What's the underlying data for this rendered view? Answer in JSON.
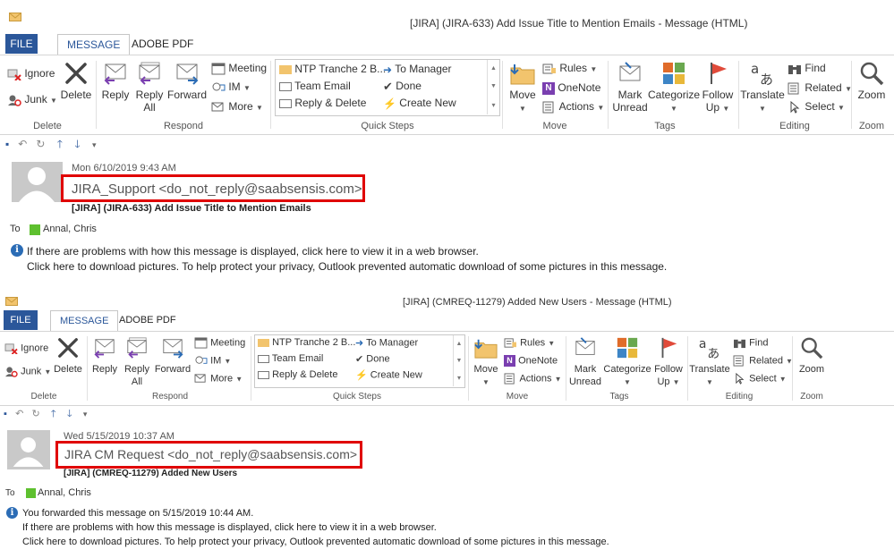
{
  "windows": [
    {
      "title": "[JIRA] (JIRA-633) Add Issue Title to Mention Emails - Message (HTML)",
      "tabs": [
        "FILE",
        "MESSAGE",
        "ADOBE PDF"
      ],
      "ribbon": {
        "delete": {
          "ignore": "Ignore",
          "junk": "Junk",
          "delete": "Delete",
          "label": "Delete"
        },
        "respond": {
          "reply": "Reply",
          "reply_all_1": "Reply",
          "reply_all_2": "All",
          "forward": "Forward",
          "meeting": "Meeting",
          "im": "IM",
          "more": "More",
          "label": "Respond"
        },
        "quick_steps": {
          "items": [
            "NTP Tranche 2 B...",
            "To Manager",
            "Team Email",
            "Done",
            "Reply & Delete",
            "Create New"
          ],
          "label": "Quick Steps"
        },
        "move": {
          "move": "Move",
          "rules": "Rules",
          "onenote": "OneNote",
          "actions": "Actions",
          "label": "Move"
        },
        "tags": {
          "mark_1": "Mark",
          "mark_2": "Unread",
          "categorize": "Categorize",
          "follow_1": "Follow",
          "follow_2": "Up",
          "label": "Tags"
        },
        "editing": {
          "translate": "Translate",
          "find": "Find",
          "related": "Related",
          "select": "Select",
          "label": "Editing"
        },
        "zoom": {
          "zoom": "Zoom",
          "label": "Zoom"
        }
      },
      "message": {
        "date": "Mon 6/10/2019 9:43 AM",
        "sender": "JIRA_Support <do_not_reply@saabsensis.com>",
        "subject": "[JIRA] (JIRA-633) Add Issue Title to Mention Emails",
        "to_label": "To",
        "to_name": "Annal, Chris",
        "info_lines": [
          "If there are problems with how this message is displayed, click here to view it in a web browser.",
          "Click here to download pictures. To help protect your privacy, Outlook prevented automatic download of some pictures in this message."
        ]
      }
    },
    {
      "title": "[JIRA] (CMREQ-11279) Added New Users - Message (HTML)",
      "tabs": [
        "FILE",
        "MESSAGE",
        "ADOBE PDF"
      ],
      "ribbon": {
        "delete": {
          "ignore": "Ignore",
          "junk": "Junk",
          "delete": "Delete",
          "label": "Delete"
        },
        "respond": {
          "reply": "Reply",
          "reply_all_1": "Reply",
          "reply_all_2": "All",
          "forward": "Forward",
          "meeting": "Meeting",
          "im": "IM",
          "more": "More",
          "label": "Respond"
        },
        "quick_steps": {
          "items": [
            "NTP Tranche 2 B...",
            "To Manager",
            "Team Email",
            "Done",
            "Reply & Delete",
            "Create New"
          ],
          "label": "Quick Steps"
        },
        "move": {
          "move": "Move",
          "rules": "Rules",
          "onenote": "OneNote",
          "actions": "Actions",
          "label": "Move"
        },
        "tags": {
          "mark_1": "Mark",
          "mark_2": "Unread",
          "categorize": "Categorize",
          "follow_1": "Follow",
          "follow_2": "Up",
          "label": "Tags"
        },
        "editing": {
          "translate": "Translate",
          "find": "Find",
          "related": "Related",
          "select": "Select",
          "label": "Editing"
        },
        "zoom": {
          "zoom": "Zoom",
          "label": "Zoom"
        }
      },
      "message": {
        "date": "Wed 5/15/2019 10:37 AM",
        "sender": "JIRA CM Request <do_not_reply@saabsensis.com>",
        "subject": "[JIRA] (CMREQ-11279) Added New Users",
        "to_label": "To",
        "to_name": "Annal, Chris",
        "info_lines": [
          "You forwarded this message on 5/15/2019 10:44 AM.",
          "If there are problems with how this message is displayed, click here to view it in a web browser.",
          "Click here to download pictures. To help protect your privacy, Outlook prevented automatic download of some pictures in this message."
        ]
      }
    }
  ],
  "colors": {
    "file_tab": "#2b579a",
    "highlight_box": "#e00000",
    "status_green": "#5ec02f",
    "info_icon": "#2b6cb5"
  }
}
